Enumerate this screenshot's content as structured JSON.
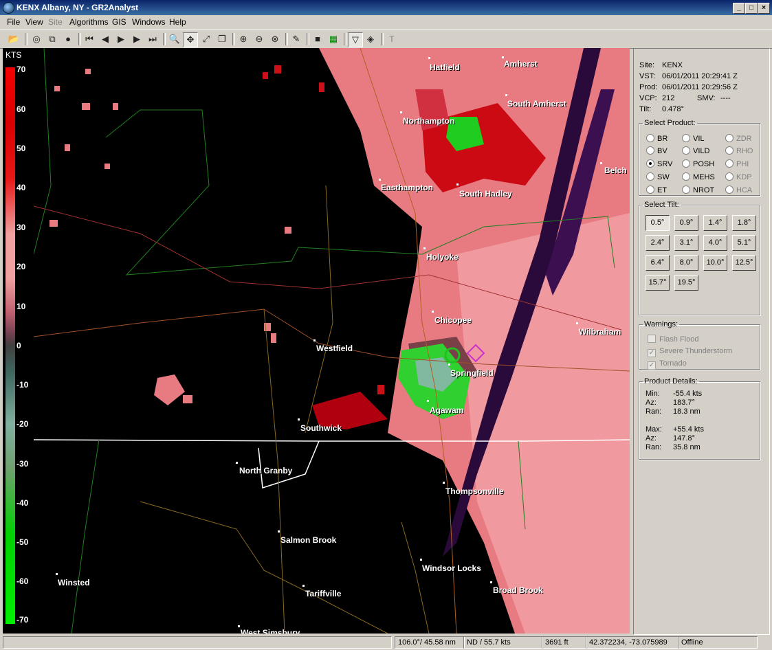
{
  "window": {
    "title": "KENX Albany, NY - GR2Analyst"
  },
  "menu": [
    "File",
    "View",
    "Site",
    "Algorithms",
    "GIS",
    "Windows",
    "Help"
  ],
  "toolbar_icons": [
    "open-icon",
    "record-icon",
    "copy-icon",
    "globe-icon",
    "first-frame-icon",
    "prev-frame-icon",
    "play-icon",
    "next-frame-icon",
    "last-frame-icon",
    "zoom-icon",
    "pan-icon",
    "measure-icon",
    "layers-icon",
    "zoom-in-icon",
    "zoom-out-icon",
    "zoom-reset-icon",
    "pencil-icon",
    "stop-icon",
    "grid-icon",
    "triangle-tool-icon",
    "diamond-tool-icon",
    "text-tool-icon"
  ],
  "scale": {
    "unit": "KTS",
    "ticks": [
      "70",
      "60",
      "50",
      "40",
      "30",
      "20",
      "10",
      "0",
      "-10",
      "-20",
      "-30",
      "-40",
      "-50",
      "-60",
      "-70"
    ]
  },
  "map": {
    "cities": [
      "Hatfield",
      "Amherst",
      "South Amherst",
      "Northampton",
      "Easthampton",
      "South Hadley",
      "Belch",
      "Holyoke",
      "Chicopee",
      "Wilbraham",
      "Westfield",
      "Springfield",
      "Agawam",
      "Southwick",
      "North Granby",
      "Thompsonville",
      "Salmon Brook",
      "Windsor Locks",
      "Broad Brook",
      "Winsted",
      "Tariffville",
      "West Simsbury"
    ]
  },
  "info": {
    "site_label": "Site:",
    "site": "KENX",
    "vst_label": "VST:",
    "vst": "06/01/2011  20:29:41 Z",
    "prod_label": "Prod:",
    "prod": "06/01/2011  20:29:56 Z",
    "vcp_label": "VCP:",
    "vcp": "212",
    "smv_label": "SMV:",
    "smv": "----",
    "tilt_label": "Tilt:",
    "tilt": "0.478°"
  },
  "select_product": {
    "legend": "Select Product:",
    "items": [
      {
        "label": "BR",
        "state": "enabled"
      },
      {
        "label": "VIL",
        "state": "enabled"
      },
      {
        "label": "ZDR",
        "state": "disabled"
      },
      {
        "label": "BV",
        "state": "enabled"
      },
      {
        "label": "VILD",
        "state": "enabled"
      },
      {
        "label": "RHO",
        "state": "disabled"
      },
      {
        "label": "SRV",
        "state": "selected"
      },
      {
        "label": "POSH",
        "state": "enabled"
      },
      {
        "label": "PHI",
        "state": "disabled"
      },
      {
        "label": "SW",
        "state": "enabled"
      },
      {
        "label": "MEHS",
        "state": "enabled"
      },
      {
        "label": "KDP",
        "state": "disabled"
      },
      {
        "label": "ET",
        "state": "enabled"
      },
      {
        "label": "NROT",
        "state": "enabled"
      },
      {
        "label": "HCA",
        "state": "disabled"
      }
    ]
  },
  "select_tilt": {
    "legend": "Select Tilt:",
    "selected": "0.5°",
    "tilts": [
      "0.5°",
      "0.9°",
      "1.4°",
      "1.8°",
      "2.4°",
      "3.1°",
      "4.0°",
      "5.1°",
      "6.4°",
      "8.0°",
      "10.0°",
      "12.5°",
      "15.7°",
      "19.5°"
    ]
  },
  "warnings": {
    "legend": "Warnings:",
    "items": [
      {
        "label": "Flash Flood",
        "checked": false
      },
      {
        "label": "Severe Thunderstorm",
        "checked": true
      },
      {
        "label": "Tornado",
        "checked": true
      }
    ]
  },
  "product_details": {
    "legend": "Product Details:",
    "min_label": "Min:",
    "min": "-55.4 kts",
    "az1_label": "Az:",
    "az1": "183.7°",
    "ran1_label": "Ran:",
    "ran1": "18.3 nm",
    "max_label": "Max:",
    "max": "+55.4 kts",
    "az2_label": "Az:",
    "az2": "147.8°",
    "ran2_label": "Ran:",
    "ran2": "35.8 nm"
  },
  "status": {
    "cursor_azran": "106.0°/ 45.58 nm",
    "value": "ND / 55.7 kts",
    "height": "3691 ft",
    "latlon": "42.372234, -73.075989",
    "connection": "Offline"
  }
}
